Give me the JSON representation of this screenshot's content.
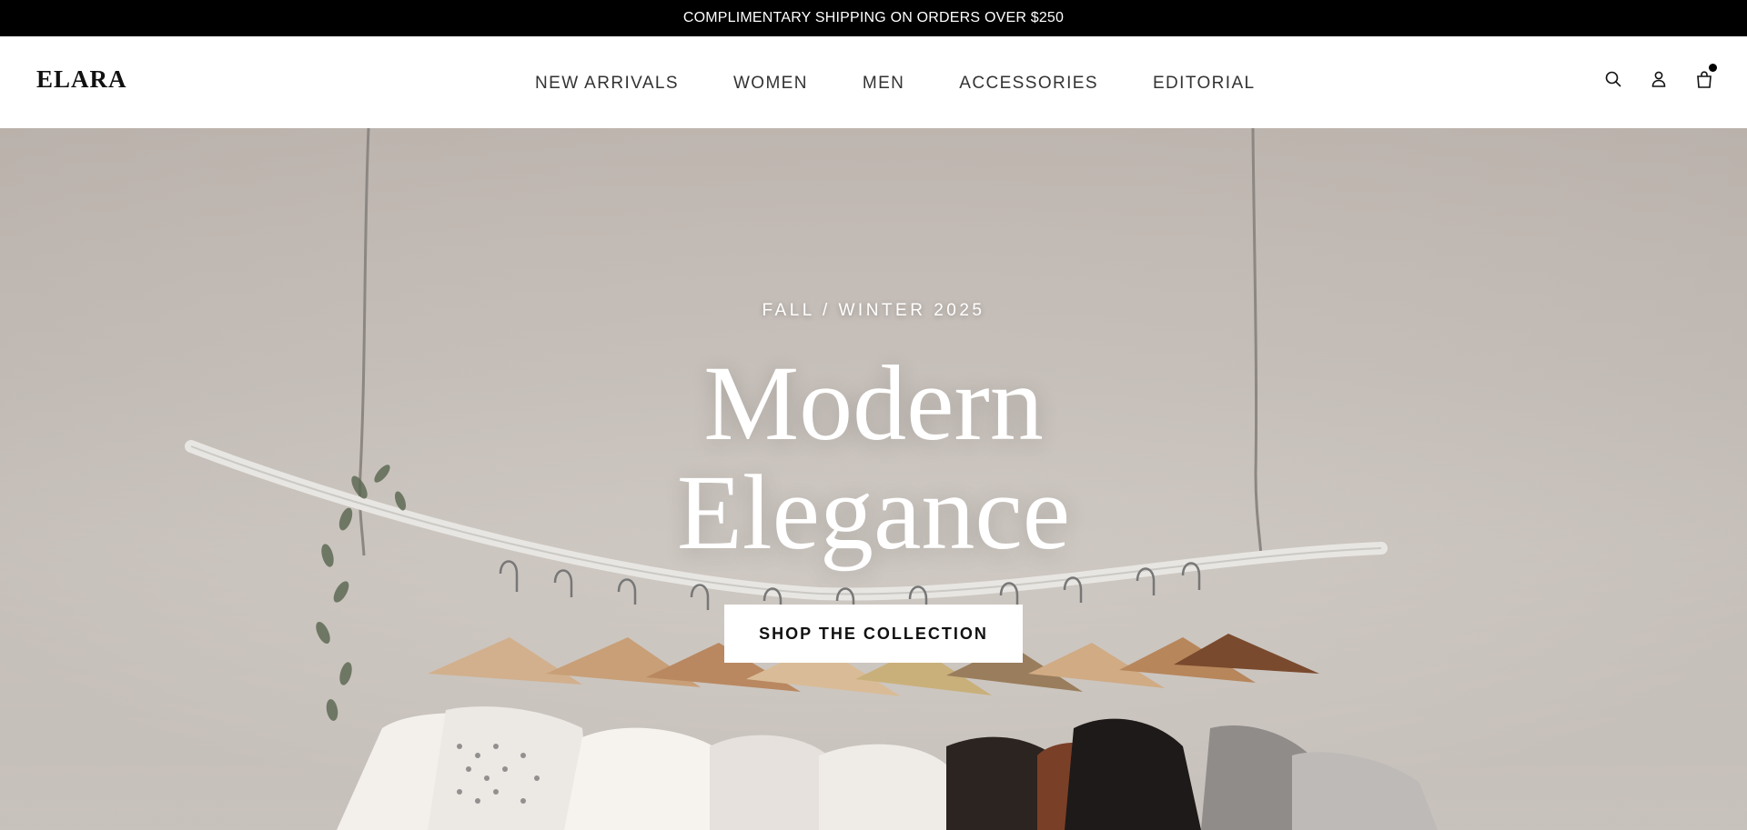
{
  "announcement": {
    "text": "COMPLIMENTARY SHIPPING ON ORDERS OVER $250"
  },
  "header": {
    "logo": "ELARA",
    "nav": [
      {
        "label": "NEW ARRIVALS"
      },
      {
        "label": "WOMEN"
      },
      {
        "label": "MEN"
      },
      {
        "label": "ACCESSORIES"
      },
      {
        "label": "EDITORIAL"
      }
    ],
    "icons": [
      "search-icon",
      "account-icon",
      "shopping-bag-icon"
    ]
  },
  "hero": {
    "eyebrow": "FALL / WINTER 2025",
    "headline_line1": "Modern",
    "headline_line2": "Elegance",
    "cta_label": "SHOP THE COLLECTION"
  },
  "colors": {
    "announcement_bg": "#000000",
    "accent": "#111111",
    "hero_bg": "#c7c0ba"
  }
}
